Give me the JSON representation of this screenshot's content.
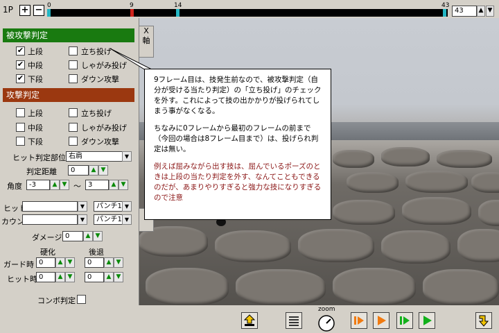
{
  "player": {
    "label": "1P",
    "plus": "+",
    "minus": "−"
  },
  "timeline": {
    "ticks": [
      {
        "label": "0",
        "color": "#23b6c4"
      },
      {
        "label": "9",
        "color": "#d0241c"
      },
      {
        "label": "14",
        "color": "#23b6c4"
      },
      {
        "label": "43",
        "color": "#23b6c4"
      }
    ],
    "frame_value": "43"
  },
  "hurt": {
    "title": "被攻撃判定",
    "color": "#197a10",
    "checks": [
      {
        "label": "上段",
        "checked": true
      },
      {
        "label": "中段",
        "checked": true
      },
      {
        "label": "下段",
        "checked": true
      }
    ],
    "throws": [
      "立ち投げ",
      "しゃがみ投げ",
      "ダウン攻撃"
    ]
  },
  "attack": {
    "title": "攻撃判定",
    "color": "#9b3810",
    "checks": [
      "上段",
      "中段",
      "下段"
    ],
    "throws": [
      "立ち投げ",
      "しゃがみ投げ",
      "ダウン攻撃"
    ],
    "hit_part_label": "ヒット判定部位",
    "hit_part_value": "右肩",
    "distance_label": "判定距離",
    "distance_value": "0",
    "angle_label": "角度",
    "angle_from": "-3",
    "angle_sep": "〜",
    "angle_to": "3",
    "hit_label": "ヒット",
    "hit_value": "パンチ1",
    "counter_label": "カウンタ",
    "counter_value": "パンチ1",
    "damage_label": "ダメージ",
    "damage_value": "0",
    "stiff_label": "硬化",
    "back_label": "後退",
    "guard_label": "ガード時",
    "guard_stiff": "0",
    "guard_back": "0",
    "hit_time_label": "ヒット時",
    "hit_stiff": "0",
    "hit_back": "0",
    "combo_label": "コンボ判定"
  },
  "side_tabs": [
    "X",
    "軸"
  ],
  "tooltip": {
    "p1": "9フレーム目は、技発生前なので、被攻撃判定（自分が受ける当たり判定）の「立ち投げ」のチェックを外す。これによって技の出かかりが投げられてしまう事がなくなる。",
    "p2": "ちなみに0フレームから最初のフレームの前まで（今回の場合は8フレーム目まで）は、投げられ判定は無い。",
    "p3": "例えば屈みながら出す技は、屈んでいるポーズのときは上段の当たり判定を外す、なんてこともできるのだが、あまりやりすぎると強力な技になりすぎるので注意"
  },
  "bottom": {
    "zoom_label": "zoom"
  }
}
